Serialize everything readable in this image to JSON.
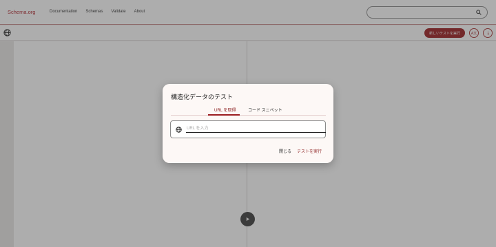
{
  "nav": {
    "brand": "Schema.org",
    "links": [
      "Documentation",
      "Schemas",
      "Validate",
      "About"
    ],
    "search_placeholder": ""
  },
  "toolbar": {
    "run_new_label": "新しいテストを実行",
    "lang_label": "A文"
  },
  "dialog": {
    "title": "構造化データのテスト",
    "tabs": [
      {
        "label": "URL を取得",
        "active": true
      },
      {
        "label": "コード スニペット",
        "active": false
      }
    ],
    "url_placeholder": "URL を入力",
    "url_value": "",
    "close_label": "閉じる",
    "run_label": "テストを実行"
  },
  "colors": {
    "brand": "#b0252c",
    "accent": "#9b1c1f"
  },
  "icons": [
    "globe-icon",
    "search-icon",
    "info-icon",
    "play-icon"
  ]
}
